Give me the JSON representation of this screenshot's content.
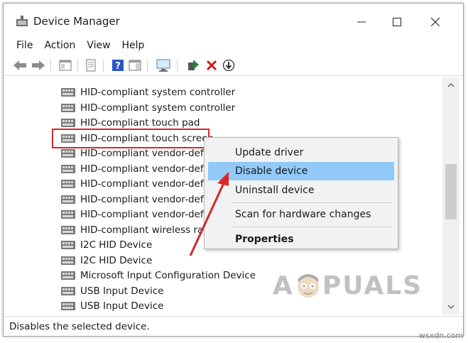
{
  "window": {
    "title": "Device Manager"
  },
  "menu": [
    "File",
    "Action",
    "View",
    "Help"
  ],
  "toolbar": {
    "icons": [
      "back-arrow-icon",
      "forward-arrow-icon",
      "show-hide-tree-icon",
      "properties-icon",
      "help-icon",
      "action-pane-icon",
      "monitor-scan-icon",
      "update-driver-icon",
      "uninstall-x-icon",
      "disable-device-icon"
    ],
    "uninstall_color": "#d11a1a",
    "update_color": "#1e8a2e",
    "help_color": "#2a58c8"
  },
  "tree": {
    "items": [
      "HID-compliant system controller",
      "HID-compliant system controller",
      "HID-compliant touch pad",
      "HID-compliant touch screen",
      "HID-compliant vendor-defir",
      "HID-compliant vendor-defir",
      "HID-compliant vendor-defir",
      "HID-compliant vendor-defir",
      "HID-compliant vendor-defir",
      "HID-compliant wireless radi",
      "I2C HID Device",
      "I2C HID Device",
      "Microsoft Input Configuration Device",
      "USB Input Device",
      "USB Input Device"
    ],
    "selected_index": 3,
    "highlight_color": "#d62828"
  },
  "context_menu": {
    "items": [
      {
        "label": "Update driver"
      },
      {
        "label": "Disable device"
      },
      {
        "label": "Uninstall device"
      },
      {
        "label": "Scan for hardware changes"
      },
      {
        "label": "Properties"
      }
    ],
    "active_index": 1,
    "active_color": "#91c9f7"
  },
  "status": {
    "text": "Disables the selected device."
  },
  "watermark": {
    "text_left": "A",
    "text_right": "PUALS",
    "corner": "wsxdn.com"
  }
}
